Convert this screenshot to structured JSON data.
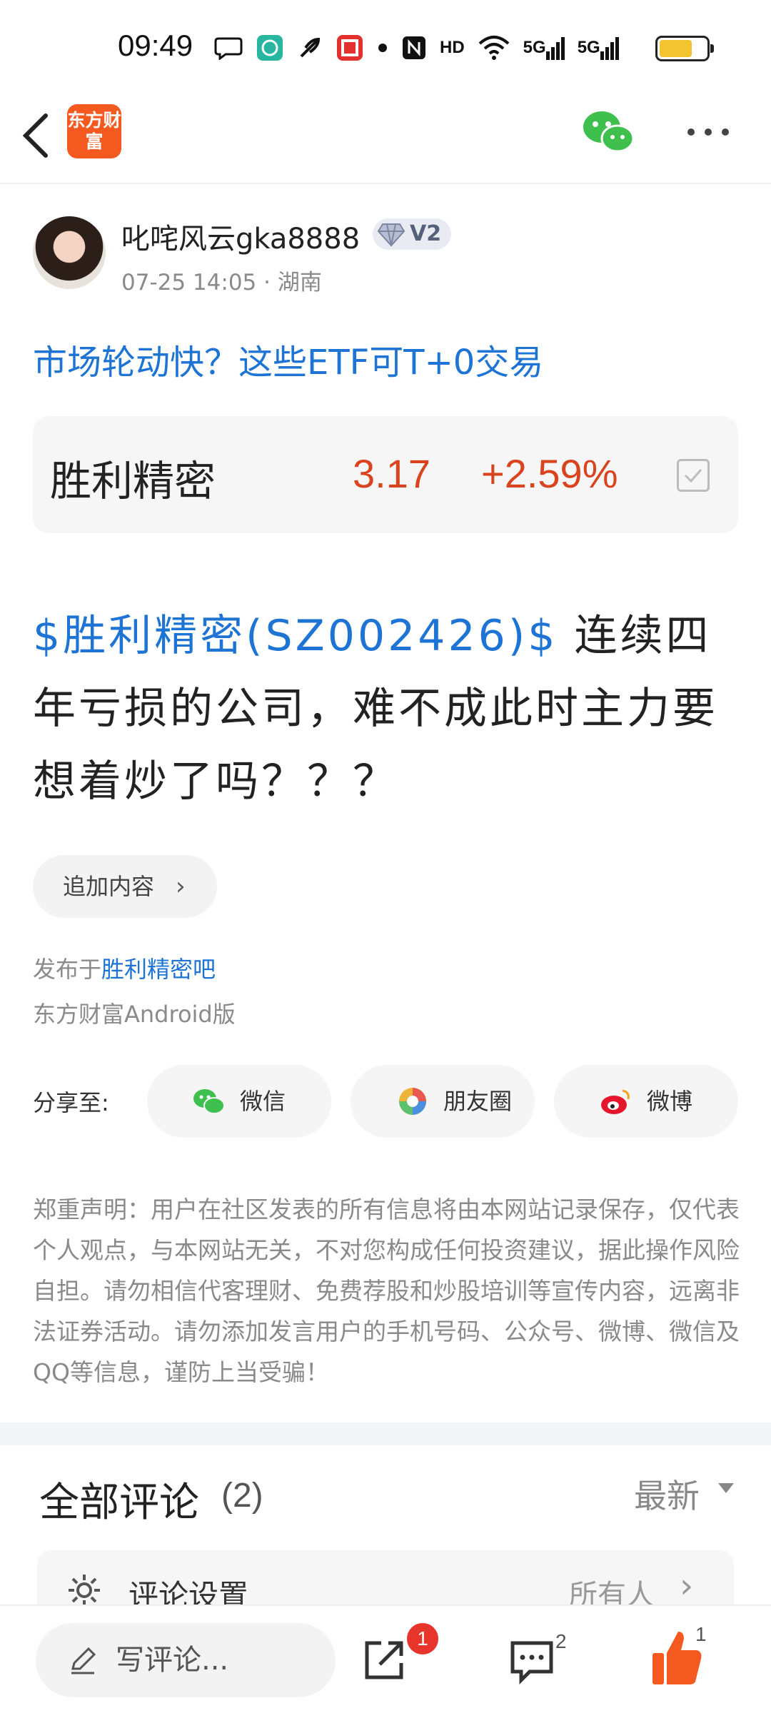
{
  "status_bar": {
    "time": "09:49",
    "icons": [
      "chat-bubble-icon",
      "fingerprint-icon",
      "feather-icon",
      "app-icon",
      "dot-icon",
      "nfc-icon",
      "hd-icon",
      "wifi-icon",
      "signal-5g-icon",
      "signal-5g-icon",
      "battery-icon"
    ],
    "hd_label": "HD",
    "signal_label_1": "5G",
    "signal_label_2": "5G",
    "battery_level": 0.7,
    "battery_color": "#f2c530"
  },
  "header": {
    "logo_text": "东方财富",
    "logo_color": "#f45a1f",
    "wechat_color": "#3fbf4e"
  },
  "post": {
    "author_name": "叱咤风云gka8888",
    "level_badge": "V2",
    "time": "07-25 14:05",
    "location": "湖南",
    "meta_separator": " · ",
    "promo_link": "市场轮动快？这些ETF可T+0交易",
    "stock": {
      "name": "胜利精密",
      "price": "3.17",
      "change": "+2.59%",
      "color": "#d9441f"
    },
    "body_tag": "$胜利精密(SZ002426)$",
    "body_text": " 连续四年亏损的公司，难不成此时主力要想着炒了吗？？？",
    "append_label": "追加内容",
    "published_prefix": "发布于",
    "published_bar": "胜利精密吧",
    "client": "东方财富Android版"
  },
  "share": {
    "label": "分享至:",
    "wechat": "微信",
    "moments": "朋友圈",
    "weibo": "微博"
  },
  "disclaimer": "郑重声明：用户在社区发表的所有信息将由本网站记录保存，仅代表个人观点，与本网站无关，不对您构成任何投资建议，据此操作风险自担。请勿相信代客理财、免费荐股和炒股培训等宣传内容，远离非法证券活动。请勿添加发言用户的手机号码、公众号、微博、微信及QQ等信息，谨防上当受骗！",
  "comments": {
    "title": "全部评论",
    "count": "(2)",
    "sort_label": "最新",
    "settings_label": "评论设置",
    "settings_value": "所有人"
  },
  "bottom_bar": {
    "input_placeholder": "写评论...",
    "share_badge": "1",
    "comment_count": "2",
    "like_count": "1",
    "like_color": "#f45a1f"
  },
  "colors": {
    "link_blue": "#1d74d4",
    "rise_red": "#d9441f"
  }
}
